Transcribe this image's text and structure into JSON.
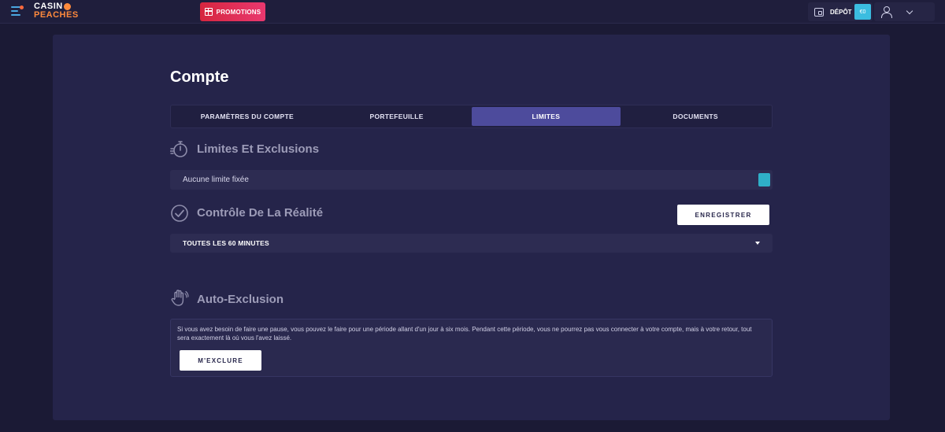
{
  "header": {
    "logo_line1": "CASIN",
    "logo_line2": "PEACHES",
    "promotions_label": "PROMOTIONS",
    "deposit_label": "DÉPÔT",
    "balance": "€0"
  },
  "page": {
    "title": "Compte"
  },
  "tabs": [
    {
      "label": "PARAMÈTRES DU COMPTE",
      "active": false
    },
    {
      "label": "PORTEFEUILLE",
      "active": false
    },
    {
      "label": "LIMITES",
      "active": true
    },
    {
      "label": "DOCUMENTS",
      "active": false
    }
  ],
  "limits": {
    "title": "Limites Et Exclusions",
    "no_limit_text": "Aucune limite fixée"
  },
  "reality_check": {
    "title": "Contrôle De La Réalité",
    "save_label": "ENREGISTRER",
    "selected_interval": "TOUTES LES 60 MINUTES"
  },
  "self_exclusion": {
    "title": "Auto-Exclusion",
    "description": "Si vous avez besoin de faire une pause, vous pouvez le faire pour une période allant d'un jour à six mois. Pendant cette période, vous ne pourrez pas vous connecter à votre compte, mais à votre retour, tout sera exactement là où vous l'avez laissé.",
    "button_label": "M'EXCLURE"
  },
  "colors": {
    "accent": "#4d4b9c",
    "promo": "#d6263f",
    "toggle": "#2fb0c8",
    "balance_badge": "#3bbde0"
  }
}
